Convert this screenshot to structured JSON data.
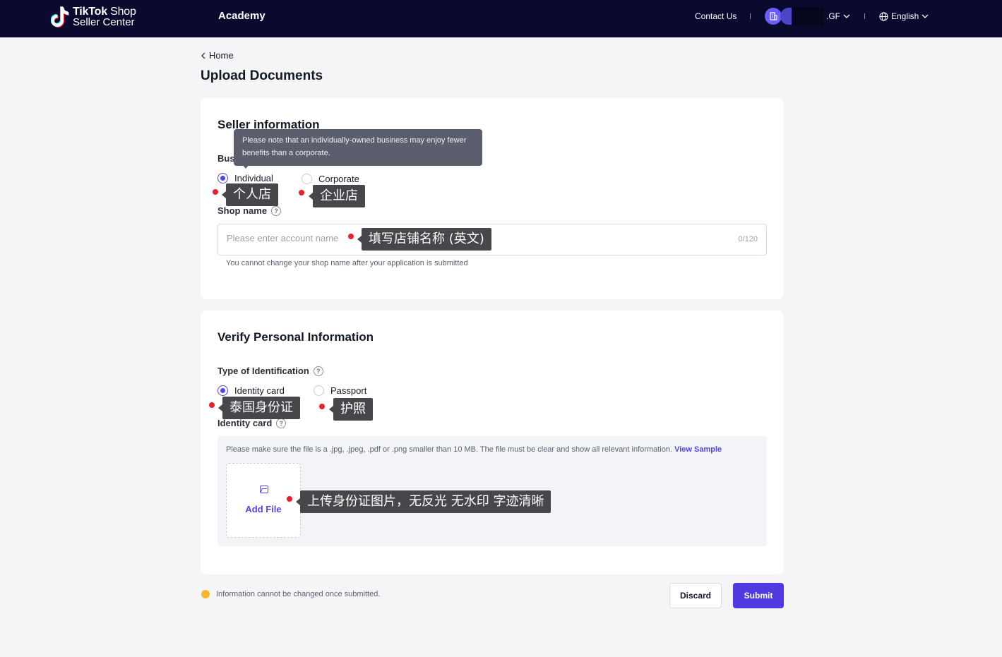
{
  "header": {
    "brand_line1_bold": "TikTok",
    "brand_line1_rest": " Shop",
    "brand_line2": "Seller Center",
    "academy": "Academy",
    "contact": "Contact Us",
    "account_suffix": ".GF",
    "language": "English"
  },
  "breadcrumb": {
    "home": "Home"
  },
  "page_title": "Upload Documents",
  "seller_info": {
    "title": "Seller information",
    "business_type_label": "Business type",
    "options": {
      "individual": "Individual",
      "corporate": "Corporate"
    },
    "selected": "Individual",
    "tooltip": "Please note that an individually-owned business may enjoy fewer benefits than a corporate.",
    "shop_name_label": "Shop name",
    "shop_name_placeholder": "Please enter account name",
    "shop_name_value": "",
    "shop_name_counter": "0/120",
    "shop_name_hint": "You cannot change your shop name after your application is submitted"
  },
  "personal_info": {
    "title": "Verify Personal Information",
    "id_type_label": "Type of Identification",
    "options": {
      "identity_card": "Identity card",
      "passport": "Passport"
    },
    "selected": "Identity card",
    "identity_card_label": "Identity card",
    "upload_note": "Please make sure the file is a .jpg, .jpeg, .pdf or .png smaller than 10 MB. The file must be clear and show all relevant information.",
    "view_sample": "View Sample",
    "add_file": "Add File"
  },
  "annotations": {
    "individual": "个人店",
    "corporate": "企业店",
    "shop_name": "填写店铺名称 (英文)",
    "identity_card": "泰国身份证",
    "passport": "护照",
    "upload": "上传身份证图片，无反光 无水印 字迹清晰"
  },
  "footer": {
    "note": "Information cannot be changed once submitted.",
    "discard": "Discard",
    "submit": "Submit"
  },
  "colors": {
    "header_bg": "#0a0a2e",
    "accent": "#4f3ae0",
    "annotation_bg": "#46474b",
    "annotation_dot": "#e8202a",
    "warning": "#f5b731"
  }
}
